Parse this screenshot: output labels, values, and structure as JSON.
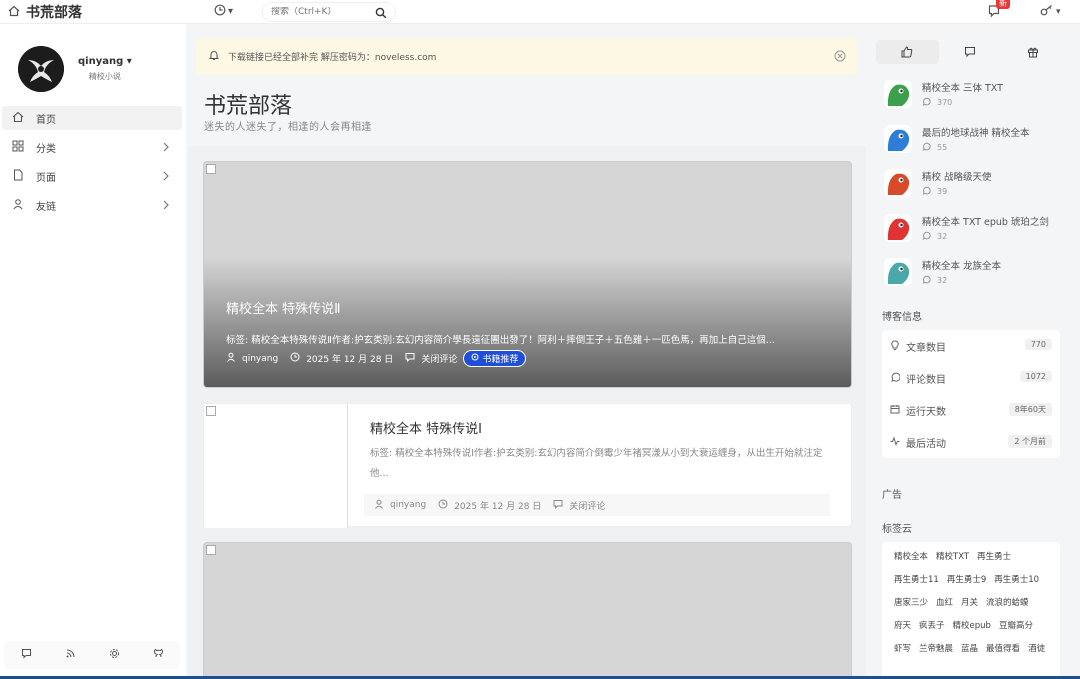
{
  "site": {
    "title": "书荒部落"
  },
  "search": {
    "placeholder": "搜索（Ctrl+K）"
  },
  "notifications": {
    "badge": "新"
  },
  "profile": {
    "username": "qinyang",
    "subtitle": "精校小说"
  },
  "nav": [
    {
      "label": "首页",
      "icon": "home-icon",
      "active": true
    },
    {
      "label": "分类",
      "icon": "grid-icon",
      "chevron": true
    },
    {
      "label": "页面",
      "icon": "page-icon",
      "chevron": true
    },
    {
      "label": "友链",
      "icon": "user-icon",
      "chevron": true
    }
  ],
  "notice": {
    "text": "下载链接已经全部补完 解压密码为：noveless.com"
  },
  "page": {
    "title": "书荒部落",
    "subtitle": "迷失的人迷失了，相逢的人会再相逢"
  },
  "posts": [
    {
      "title": "精校全本 特殊传说Ⅱ",
      "desc": "标签: 精校全本特殊传说Ⅱ作者:护玄类别:玄幻内容简介學長遠征團出發了！阿利＋摔倒王子＋五色雞＋一匹色馬，再加上自己這個...",
      "author": "qinyang",
      "date": "2025 年 12 月 28 日",
      "comments": "关闭评论",
      "tag": "书籍推荐"
    },
    {
      "title": "精校全本 特殊传说Ⅰ",
      "desc": "标签: 精校全本特殊传说Ⅰ作者:护玄类别:玄幻内容简介倒霉少年褚冥漾从小到大衰运缠身，从出生开始就注定他...",
      "author": "qinyang",
      "date": "2025 年 12 月 28 日",
      "comments": "关闭评论"
    }
  ],
  "hot": [
    {
      "title": "精校全本 三体 TXT",
      "count": "370",
      "color": "#3aa04a"
    },
    {
      "title": "最后的地球战神 精校全本",
      "count": "55",
      "color": "#2e7dd6"
    },
    {
      "title": "精校 战略级天使",
      "count": "39",
      "color": "#d84a2a"
    },
    {
      "title": "精校全本 TXT epub 琥珀之剑",
      "count": "32",
      "color": "#e03333"
    },
    {
      "title": "精校全本 龙族全本",
      "count": "32",
      "color": "#4aa8a8"
    }
  ],
  "blog_info": {
    "title": "博客信息",
    "stats": [
      {
        "label": "文章数目",
        "value": "770",
        "icon": "bulb-icon"
      },
      {
        "label": "评论数目",
        "value": "1072",
        "icon": "comment-icon"
      },
      {
        "label": "运行天数",
        "value": "8年60天",
        "icon": "calendar-icon"
      },
      {
        "label": "最后活动",
        "value": "2 个月前",
        "icon": "activity-icon"
      }
    ]
  },
  "ad": {
    "title": "广告"
  },
  "tag_cloud": {
    "title": "标签云",
    "tags": [
      "精校全本",
      "精校TXT",
      "再生勇士",
      "再生勇士11",
      "再生勇士9",
      "再生勇士10",
      "唐家三少",
      "血红",
      "月关",
      "流浪的蛤蟆",
      "府天",
      "疯丢子",
      "精校epub",
      "豆瓣高分",
      "虾写",
      "兰帝魅晨",
      "蓝晶",
      "最值得看",
      "酒徒"
    ]
  }
}
